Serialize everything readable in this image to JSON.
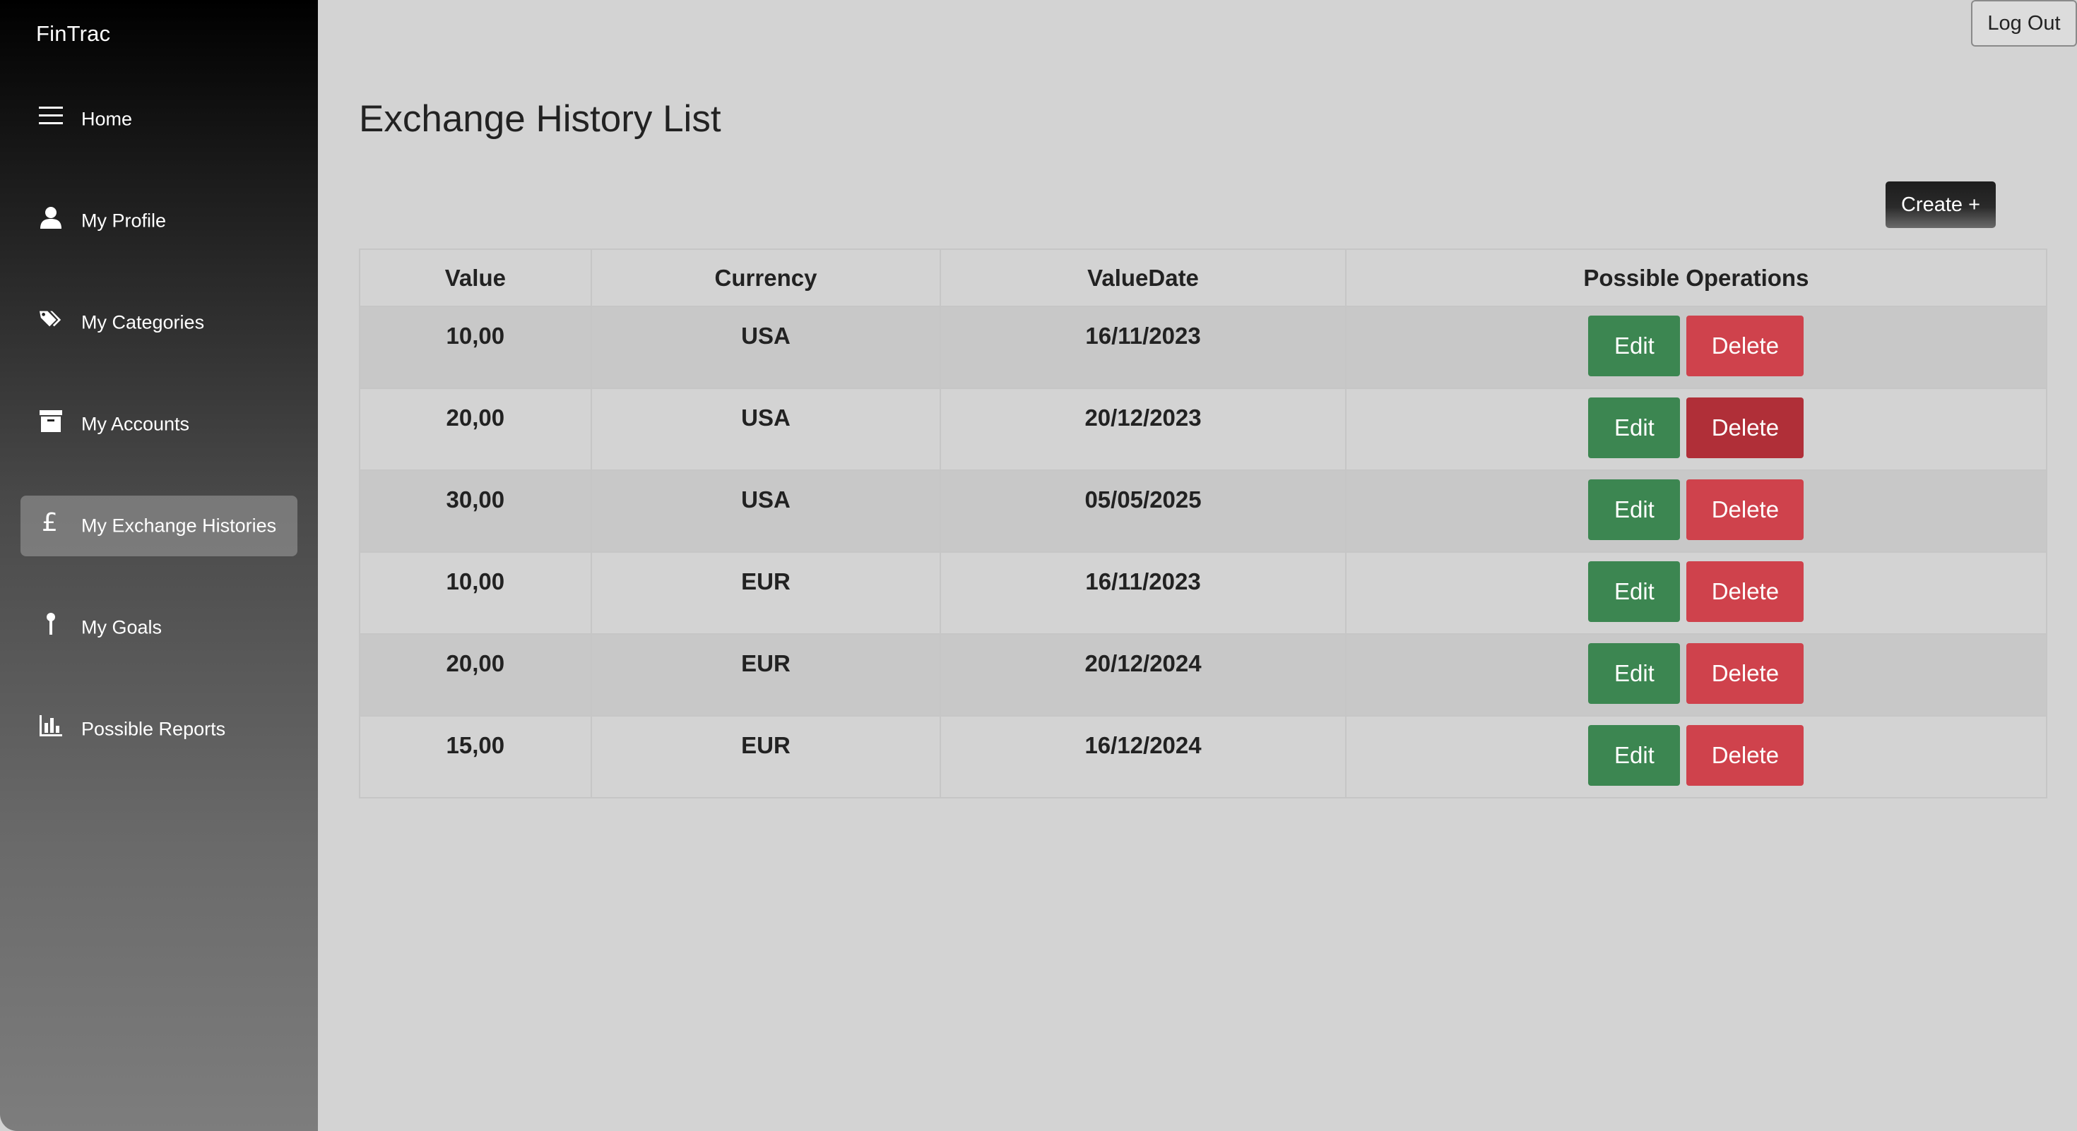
{
  "app": {
    "brand": "FinTrac"
  },
  "header": {
    "logout_label": "Log Out"
  },
  "sidebar": {
    "items": [
      {
        "label": "Home",
        "icon": "menu-icon",
        "active": false
      },
      {
        "label": "My Profile",
        "icon": "user-icon",
        "active": false
      },
      {
        "label": "My Categories",
        "icon": "tags-icon",
        "active": false
      },
      {
        "label": "My Accounts",
        "icon": "archive-icon",
        "active": false
      },
      {
        "label": "My Exchange Histories",
        "icon": "pound-icon",
        "active": true
      },
      {
        "label": "My Goals",
        "icon": "pin-icon",
        "active": false
      },
      {
        "label": "Possible Reports",
        "icon": "bar-chart-icon",
        "active": false
      }
    ]
  },
  "main": {
    "title": "Exchange History List",
    "create_label": "Create +",
    "table": {
      "columns": [
        "Value",
        "Currency",
        "ValueDate",
        "Possible Operations"
      ],
      "rows": [
        {
          "value": "10,00",
          "currency": "USA",
          "date": "16/11/2023"
        },
        {
          "value": "20,00",
          "currency": "USA",
          "date": "20/12/2023"
        },
        {
          "value": "30,00",
          "currency": "USA",
          "date": "05/05/2025"
        },
        {
          "value": "10,00",
          "currency": "EUR",
          "date": "16/11/2023"
        },
        {
          "value": "20,00",
          "currency": "EUR",
          "date": "20/12/2024"
        },
        {
          "value": "15,00",
          "currency": "EUR",
          "date": "16/12/2024"
        }
      ],
      "edit_label": "Edit",
      "delete_label": "Delete"
    }
  },
  "colors": {
    "edit": "#3c8651",
    "delete": "#cf424c",
    "delete_hover": "#b02f38"
  }
}
